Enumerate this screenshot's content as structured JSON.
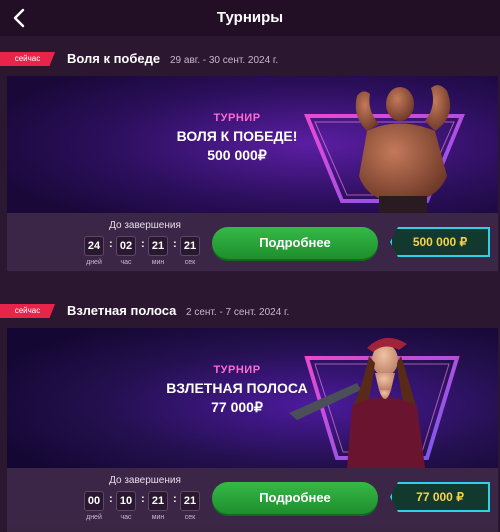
{
  "header": {
    "title": "Турниры",
    "back_icon": "chevron-left-icon"
  },
  "tournaments": [
    {
      "badge": "сейчас",
      "name": "Воля к победе",
      "dates": "29 авг. - 30 сент. 2024 г.",
      "banner": {
        "kind": "ТУРНИР",
        "title": "ВОЛЯ К ПОБЕДЕ!",
        "prize": "500 000₽"
      },
      "until_label": "До завершения",
      "timer": [
        {
          "value": "24",
          "label": "дней"
        },
        {
          "value": "02",
          "label": "час"
        },
        {
          "value": "21",
          "label": "мин"
        },
        {
          "value": "21",
          "label": "сек"
        }
      ],
      "button_label": "Подробнее",
      "prize_label": "500 000 ₽"
    },
    {
      "badge": "сейчас",
      "name": "Взлетная полоса",
      "dates": "2 сент. - 7 сент. 2024 г.",
      "banner": {
        "kind": "ТУРНИР",
        "title": "ВЗЛЕТНАЯ ПОЛОСА",
        "prize": "77 000₽"
      },
      "until_label": "До завершения",
      "timer": [
        {
          "value": "00",
          "label": "дней"
        },
        {
          "value": "10",
          "label": "час"
        },
        {
          "value": "21",
          "label": "мин"
        },
        {
          "value": "21",
          "label": "сек"
        }
      ],
      "button_label": "Подробнее",
      "prize_label": "77 000 ₽"
    }
  ],
  "colors": {
    "background": "#2b1830",
    "badge": "#e8244a",
    "button": "#2aa83b",
    "prize_border": "#2ed1e6",
    "prize_text": "#f7d24a",
    "neon_pink": "#ff6ad5"
  }
}
